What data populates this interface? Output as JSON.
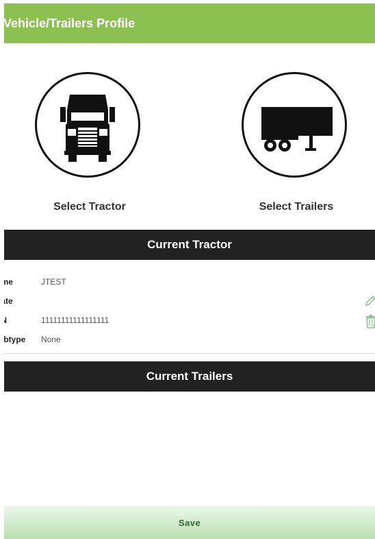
{
  "header": {
    "title": "Vehicle/Trailers Profile",
    "background_color": "#8cc152"
  },
  "pickers": {
    "tractor": {
      "label": "Select Tractor",
      "icon": "truck-icon"
    },
    "trailers": {
      "label": "Select Trailers",
      "icon": "trailer-icon"
    }
  },
  "current_tractor": {
    "section_title": "Current Tractor",
    "fields": {
      "name_label": "ame",
      "name_value": "JTEST",
      "plate_label": "late",
      "plate_value": "",
      "vin_label": "IN",
      "vin_value": "11111111111111111",
      "subtype_label": "ubtype",
      "subtype_value": "None"
    },
    "actions": {
      "edit_icon": "pencil-icon",
      "delete_icon": "trash-icon"
    }
  },
  "current_trailers": {
    "section_title": "Current Trailers"
  },
  "footer": {
    "save_label": "Save"
  }
}
